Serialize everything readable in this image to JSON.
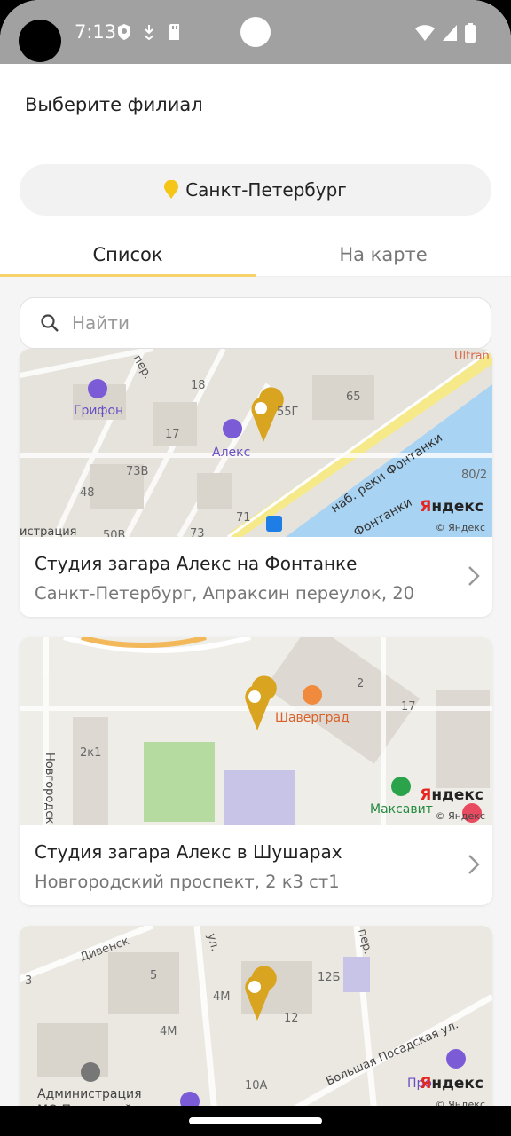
{
  "status_bar": {
    "time": "7:13",
    "icons_left": [
      "shield-icon",
      "download-icon",
      "sd-card-icon"
    ],
    "icons_right": [
      "wifi-icon",
      "signal-icon",
      "battery-icon"
    ]
  },
  "header": {
    "title": "Выберите филиал",
    "city": "Санкт-Петербург",
    "city_icon": "location-pin-icon",
    "accent_color": "#f5c518"
  },
  "tabs": [
    {
      "label": "Список",
      "active": true
    },
    {
      "label": "На карте",
      "active": false
    }
  ],
  "search": {
    "placeholder": "Найти"
  },
  "branches": [
    {
      "name": "Студия загара Алекс на Фонтанке",
      "address": "Санкт-Петербург, Апраксин переулок, 20",
      "map_labels": {
        "poi1": "Грифон",
        "poi2": "Алекс",
        "street": "наб. реки Фонтанки",
        "street2": "Фонтанки",
        "street3": "пер.",
        "n1": "18",
        "n2": "65",
        "n3": "55Г",
        "n4": "17",
        "n5": "73В",
        "n6": "48",
        "n7": "71",
        "n8": "80/2",
        "n9": "73",
        "n10": "50В",
        "poi3": "истрация",
        "poi4": "Ultran"
      }
    },
    {
      "name": "Студия загара Алекс в Шушарах",
      "address": "Новгородский проспект, 2 к3 ст1",
      "map_labels": {
        "poi1": "Шаверград",
        "poi2": "Максавит",
        "street": "Новгородск",
        "n1": "2к1",
        "n2": "2",
        "n3": "17"
      }
    },
    {
      "name": "",
      "address": "",
      "map_labels": {
        "street1": "Дивенск",
        "street2": "ул.",
        "street3": "пер.",
        "street4": "Большая Посадская ул.",
        "poi1": "Администрация",
        "poi2": "МО Посадский",
        "poi3": "Про",
        "n1": "3",
        "n2": "5",
        "n3": "4М",
        "n4": "4М",
        "n5": "12Б",
        "n6": "12",
        "n7": "10А"
      }
    }
  ],
  "map_branding": {
    "logo_first": "Я",
    "logo_rest": "ндекс",
    "copyright": "© Яндекс"
  }
}
